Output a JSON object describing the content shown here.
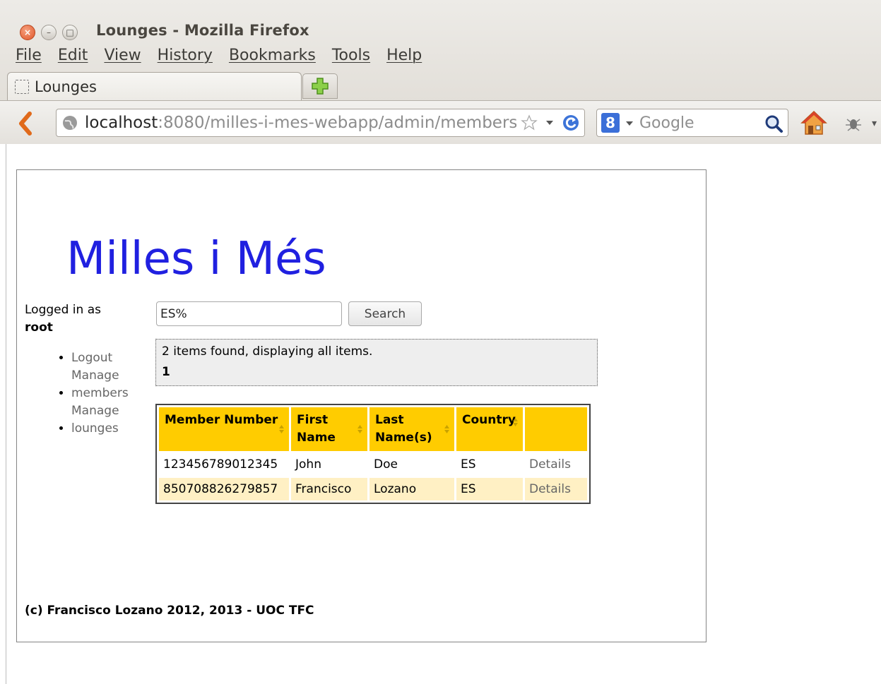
{
  "window": {
    "title": "Lounges - Mozilla Firefox"
  },
  "menu": [
    "File",
    "Edit",
    "View",
    "History",
    "Bookmarks",
    "Tools",
    "Help"
  ],
  "tab": {
    "label": "Lounges"
  },
  "urlbar": {
    "host": "localhost",
    "rest": ":8080/milles-i-mes-webapp/admin/members:"
  },
  "searchbar": {
    "engine_letter": "8",
    "placeholder": "Google"
  },
  "page": {
    "site_title": "Milles i Més",
    "login_label": "Logged in as",
    "login_user": "root",
    "nav": [
      "Logout",
      "Manage members",
      "Manage lounges"
    ],
    "search": {
      "value": "ES%",
      "button": "Search"
    },
    "results_text": "2 items found, displaying all items.",
    "page_number": "1",
    "table": {
      "headers": [
        "Member Number",
        "First Name",
        "Last Name(s)",
        "Country",
        ""
      ],
      "rows": [
        [
          "123456789012345",
          "John",
          "Doe",
          "ES",
          "Details"
        ],
        [
          "850708826279857",
          "Francisco",
          "Lozano",
          "ES",
          "Details"
        ]
      ]
    },
    "footer": "(c) Francisco Lozano 2012, 2013 - UOC TFC"
  },
  "colors": {
    "title_blue": "#2020e0",
    "header_yellow": "#ffcc00",
    "even_row": "#fff0c4"
  }
}
